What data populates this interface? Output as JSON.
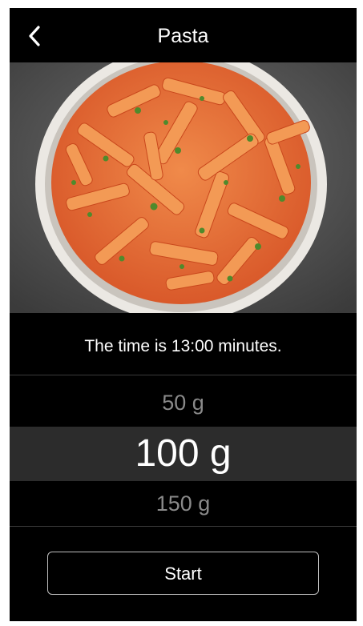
{
  "header": {
    "title": "Pasta",
    "back_icon": "chevron-left-icon"
  },
  "photo": {
    "subject": "penne-pasta-in-tomato-sauce"
  },
  "status": {
    "time_text": "The time is 13:00 minutes."
  },
  "picker": {
    "items": [
      {
        "label": "50 g",
        "selected": false
      },
      {
        "label": "100 g",
        "selected": true
      },
      {
        "label": "150 g",
        "selected": false
      }
    ]
  },
  "actions": {
    "start_label": "Start"
  },
  "colors": {
    "background": "#000000",
    "selected_row": "#2c2c2c",
    "dim_text": "#8a8a8a",
    "text": "#ffffff"
  }
}
